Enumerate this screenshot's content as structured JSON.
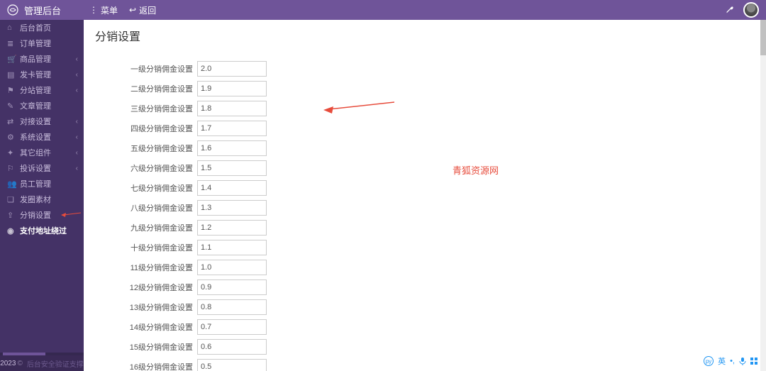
{
  "topbar": {
    "brand": "管理后台",
    "menu_label": "菜单",
    "back_label": "返回"
  },
  "sidebar": {
    "items": [
      {
        "icon": "home",
        "label": "后台首页",
        "expandable": false
      },
      {
        "icon": "list",
        "label": "订单管理",
        "expandable": false
      },
      {
        "icon": "cart",
        "label": "商品管理",
        "expandable": true
      },
      {
        "icon": "card",
        "label": "发卡管理",
        "expandable": true
      },
      {
        "icon": "site",
        "label": "分站管理",
        "expandable": true
      },
      {
        "icon": "doc",
        "label": "文章管理",
        "expandable": false
      },
      {
        "icon": "link",
        "label": "对接设置",
        "expandable": true
      },
      {
        "icon": "gear",
        "label": "系统设置",
        "expandable": true
      },
      {
        "icon": "puzzle",
        "label": "其它组件",
        "expandable": true
      },
      {
        "icon": "flag",
        "label": "投诉设置",
        "expandable": true
      },
      {
        "icon": "users",
        "label": "员工管理",
        "expandable": false
      },
      {
        "icon": "image",
        "label": "发圈素材",
        "expandable": false
      },
      {
        "icon": "share",
        "label": "分销设置",
        "expandable": false,
        "highlight": true
      },
      {
        "icon": "globe",
        "label": "支付地址绕过",
        "expandable": false,
        "active": true
      }
    ],
    "footer_year": "2023",
    "footer_text": "后台安全验证支撑"
  },
  "page": {
    "title": "分销设置",
    "watermark": "青狐资源网",
    "rows": [
      {
        "label": "一级分销佣金设置",
        "value": "2.0"
      },
      {
        "label": "二级分销佣金设置",
        "value": "1.9"
      },
      {
        "label": "三级分销佣金设置",
        "value": "1.8"
      },
      {
        "label": "四级分销佣金设置",
        "value": "1.7"
      },
      {
        "label": "五级分销佣金设置",
        "value": "1.6"
      },
      {
        "label": "六级分销佣金设置",
        "value": "1.5"
      },
      {
        "label": "七级分销佣金设置",
        "value": "1.4"
      },
      {
        "label": "八级分销佣金设置",
        "value": "1.3"
      },
      {
        "label": "九级分销佣金设置",
        "value": "1.2"
      },
      {
        "label": "十级分销佣金设置",
        "value": "1.1"
      },
      {
        "label": "11级分销佣金设置",
        "value": "1.0"
      },
      {
        "label": "12级分销佣金设置",
        "value": "0.9"
      },
      {
        "label": "13级分销佣金设置",
        "value": "0.8"
      },
      {
        "label": "14级分销佣金设置",
        "value": "0.7"
      },
      {
        "label": "15级分销佣金设置",
        "value": "0.6"
      },
      {
        "label": "16级分销佣金设置",
        "value": "0.5"
      }
    ]
  },
  "ime": {
    "mode_icon": "㋄",
    "lang": "英",
    "punct": "⁝",
    "mic": "🎤",
    "grid": "⊞"
  }
}
